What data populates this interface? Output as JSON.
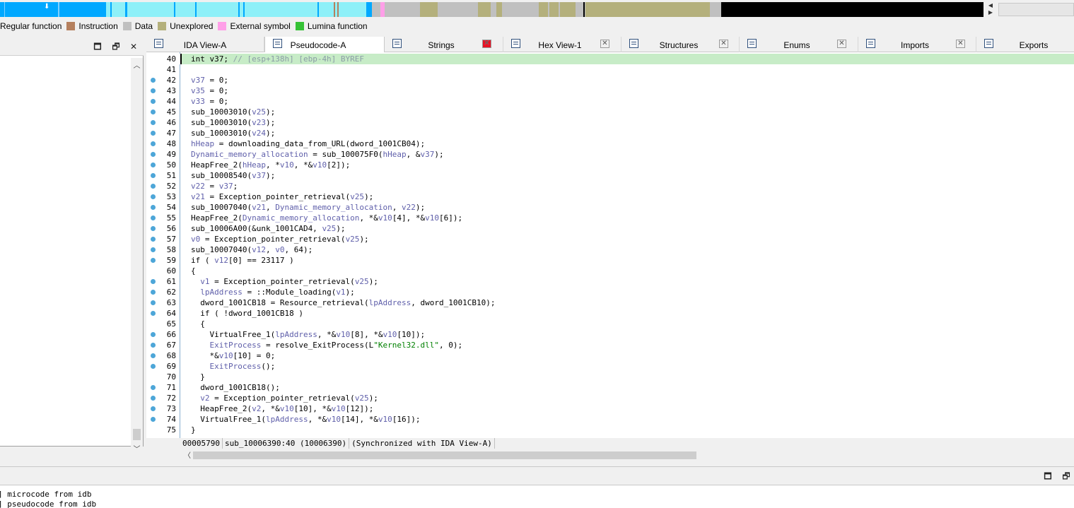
{
  "navigation_band": {
    "legend": [
      {
        "label": "Regular function",
        "color": "#00a8ff"
      },
      {
        "label": "Instruction",
        "color": "#b5805e"
      },
      {
        "label": "Data",
        "color": "#c0c0c0"
      },
      {
        "label": "Unexplored",
        "color": "#b4b07c"
      },
      {
        "label": "External symbol",
        "color": "#ff9fe8"
      },
      {
        "label": "Lumina function",
        "color": "#36c236"
      }
    ]
  },
  "tabs": [
    {
      "label": "IDA View-A",
      "active": false
    },
    {
      "label": "Pseudocode-A",
      "active": true
    },
    {
      "label": "Strings",
      "active": false
    },
    {
      "label": "Hex View-1",
      "active": false
    },
    {
      "label": "Structures",
      "active": false
    },
    {
      "label": "Enums",
      "active": false
    },
    {
      "label": "Imports",
      "active": false
    },
    {
      "label": "Exports",
      "active": false
    }
  ],
  "code": {
    "lines": [
      {
        "num": "40",
        "dot": false,
        "text": "int v37; // [esp+138h] [ebp-4h] BYREF"
      },
      {
        "num": "41",
        "dot": false,
        "text": ""
      },
      {
        "num": "42",
        "dot": true,
        "text": "v37 = 0;"
      },
      {
        "num": "43",
        "dot": true,
        "text": "v35 = 0;"
      },
      {
        "num": "44",
        "dot": true,
        "text": "v33 = 0;"
      },
      {
        "num": "45",
        "dot": true,
        "text": "sub_10003010(v25);"
      },
      {
        "num": "46",
        "dot": true,
        "text": "sub_10003010(v23);"
      },
      {
        "num": "47",
        "dot": true,
        "text": "sub_10003010(v24);"
      },
      {
        "num": "48",
        "dot": true,
        "text": "hHeap = downloading_data_from_URL(dword_1001CB04);"
      },
      {
        "num": "49",
        "dot": true,
        "text": "Dynamic_memory_allocation = sub_100075F0(hHeap, &v37);"
      },
      {
        "num": "50",
        "dot": true,
        "text": "HeapFree_2(hHeap, *v10, *&v10[2]);"
      },
      {
        "num": "51",
        "dot": true,
        "text": "sub_10008540(v37);"
      },
      {
        "num": "52",
        "dot": true,
        "text": "v22 = v37;"
      },
      {
        "num": "53",
        "dot": true,
        "text": "v21 = Exception_pointer_retrieval(v25);"
      },
      {
        "num": "54",
        "dot": true,
        "text": "sub_10007040(v21, Dynamic_memory_allocation, v22);"
      },
      {
        "num": "55",
        "dot": true,
        "text": "HeapFree_2(Dynamic_memory_allocation, *&v10[4], *&v10[6]);"
      },
      {
        "num": "56",
        "dot": true,
        "text": "sub_10006A00(&unk_1001CAD4, v25);"
      },
      {
        "num": "57",
        "dot": true,
        "text": "v0 = Exception_pointer_retrieval(v25);"
      },
      {
        "num": "58",
        "dot": true,
        "text": "sub_10007040(v12, v0, 64);"
      },
      {
        "num": "59",
        "dot": true,
        "text": "if ( v12[0] == 23117 )"
      },
      {
        "num": "60",
        "dot": false,
        "text": "{"
      },
      {
        "num": "61",
        "dot": true,
        "text": "  v1 = Exception_pointer_retrieval(v25);"
      },
      {
        "num": "62",
        "dot": true,
        "text": "  lpAddress = ::Module_loading(v1);"
      },
      {
        "num": "63",
        "dot": true,
        "text": "  dword_1001CB18 = Resource_retrieval(lpAddress, dword_1001CB10);"
      },
      {
        "num": "64",
        "dot": true,
        "text": "  if ( !dword_1001CB18 )"
      },
      {
        "num": "65",
        "dot": false,
        "text": "  {"
      },
      {
        "num": "66",
        "dot": true,
        "text": "    VirtualFree_1(lpAddress, *&v10[8], *&v10[10]);"
      },
      {
        "num": "67",
        "dot": true,
        "text": "    ExitProcess = resolve_ExitProcess(L\"Kernel32.dll\", 0);"
      },
      {
        "num": "68",
        "dot": true,
        "text": "    *&v10[10] = 0;"
      },
      {
        "num": "69",
        "dot": true,
        "text": "    ExitProcess();"
      },
      {
        "num": "70",
        "dot": false,
        "text": "  }"
      },
      {
        "num": "71",
        "dot": true,
        "text": "  dword_1001CB18();"
      },
      {
        "num": "72",
        "dot": true,
        "text": "  v2 = Exception_pointer_retrieval(v25);"
      },
      {
        "num": "73",
        "dot": true,
        "text": "  HeapFree_2(v2, *&v10[10], *&v10[12]);"
      },
      {
        "num": "74",
        "dot": true,
        "text": "  VirtualFree_1(lpAddress, *&v10[14], *&v10[16]);"
      },
      {
        "num": "75",
        "dot": false,
        "text": "}"
      }
    ]
  },
  "status": {
    "address": "00005790",
    "location": "sub_10006390:40 (10006390)",
    "sync": "(Synchronized with IDA View-A)"
  },
  "output": {
    "lines": [
      "] microcode from idb",
      "] pseudocode from idb"
    ]
  },
  "colors": {
    "highlight_line": "#c7ecc7",
    "breakpoint_dot": "#4da6d8",
    "variable": "#5f5faa",
    "comment": "#8a9ca6",
    "string": "#008000"
  }
}
